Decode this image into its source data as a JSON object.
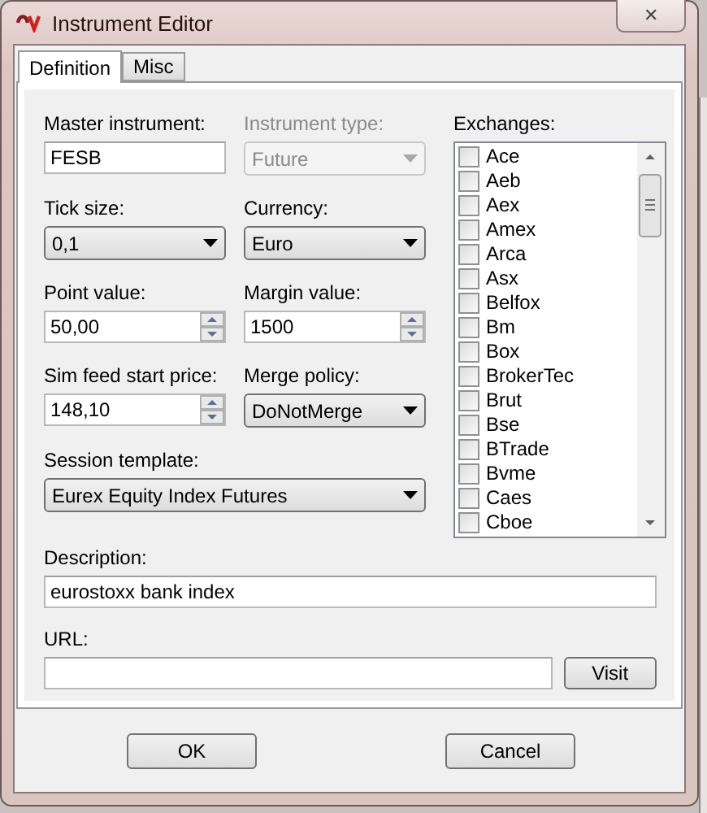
{
  "window": {
    "title": "Instrument Editor",
    "close": "✕"
  },
  "tabs": [
    {
      "label": "Definition",
      "selected": true
    },
    {
      "label": "Misc",
      "selected": false
    }
  ],
  "fields": [
    {
      "kind": "text",
      "label": "Master instrument:",
      "value": "FESB",
      "disabled": false
    },
    {
      "kind": "combo",
      "label": "Instrument type:",
      "value": "Future",
      "disabled": true
    },
    {
      "kind": "combo",
      "label": "Tick size:",
      "value": "0,1",
      "disabled": false
    },
    {
      "kind": "combo",
      "label": "Currency:",
      "value": "Euro",
      "disabled": false
    },
    {
      "kind": "spin",
      "label": "Point value:",
      "value": "50,00",
      "disabled": false
    },
    {
      "kind": "spin",
      "label": "Margin value:",
      "value": "1500",
      "disabled": false
    },
    {
      "kind": "spin",
      "label": "Sim feed start price:",
      "value": "148,10",
      "disabled": false
    },
    {
      "kind": "combo",
      "label": "Merge policy:",
      "value": "DoNotMerge",
      "disabled": false
    }
  ],
  "session_template": {
    "label": "Session template:",
    "value": "Eurex Equity Index Futures"
  },
  "exchanges": {
    "label": "Exchanges:",
    "items": [
      {
        "name": "Ace",
        "checked": false
      },
      {
        "name": "Aeb",
        "checked": false
      },
      {
        "name": "Aex",
        "checked": false
      },
      {
        "name": "Amex",
        "checked": false
      },
      {
        "name": "Arca",
        "checked": false
      },
      {
        "name": "Asx",
        "checked": false
      },
      {
        "name": "Belfox",
        "checked": false
      },
      {
        "name": "Bm",
        "checked": false
      },
      {
        "name": "Box",
        "checked": false
      },
      {
        "name": "BrokerTec",
        "checked": false
      },
      {
        "name": "Brut",
        "checked": false
      },
      {
        "name": "Bse",
        "checked": false
      },
      {
        "name": "BTrade",
        "checked": false
      },
      {
        "name": "Bvme",
        "checked": false
      },
      {
        "name": "Caes",
        "checked": false
      },
      {
        "name": "Cboe",
        "checked": false
      }
    ]
  },
  "description": {
    "label": "Description:",
    "value": "eurostoxx bank index"
  },
  "url": {
    "label": "URL:",
    "button": "Visit"
  },
  "buttons": [
    "OK",
    "Cancel"
  ]
}
